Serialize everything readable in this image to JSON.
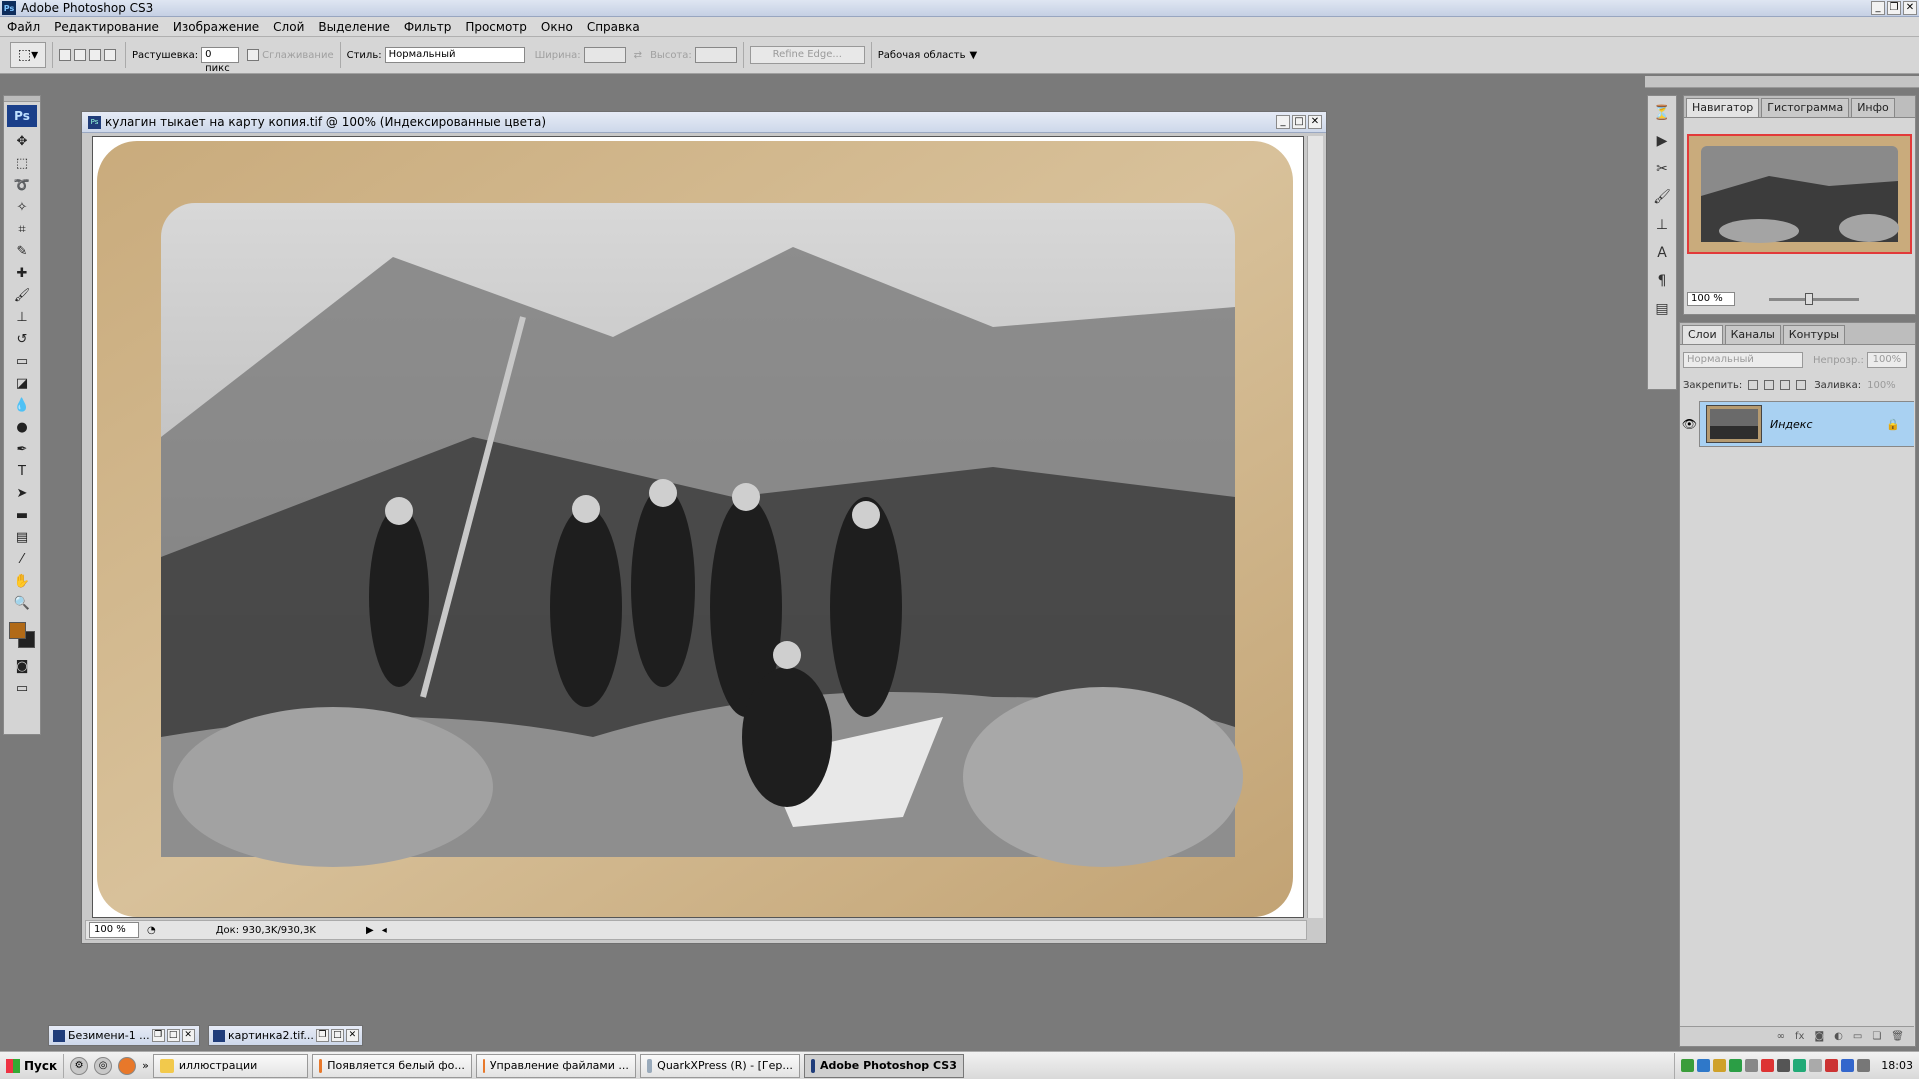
{
  "app": {
    "title": "Adobe Photoshop CS3",
    "icon": "ps-app-icon"
  },
  "menu": [
    "Файл",
    "Редактирование",
    "Изображение",
    "Слой",
    "Выделение",
    "Фильтр",
    "Просмотр",
    "Окно",
    "Справка"
  ],
  "options": {
    "feather_label": "Растушевка:",
    "feather_value": "0 пикс",
    "antialias_label": "Сглаживание",
    "style_label": "Стиль:",
    "style_value": "Нормальный",
    "width_label": "Ширина:",
    "height_label": "Высота:",
    "refine_edge": "Refine Edge...",
    "workspace": "Рабочая область"
  },
  "document": {
    "title": "кулагин тыкает на карту копия.tif @ 100% (Индексированные цвета)",
    "zoom": "100 %",
    "doc_info": "Док: 930,3K/930,3K"
  },
  "navigator": {
    "tabs": [
      "Навигатор",
      "Гистограмма",
      "Инфо"
    ],
    "zoom": "100 %"
  },
  "layers": {
    "tabs": [
      "Слои",
      "Каналы",
      "Контуры"
    ],
    "blend_mode": "Нормальный",
    "opacity_label": "Непрозр.:",
    "opacity_value": "100%",
    "lock_label": "Закрепить:",
    "fill_label": "Заливка:",
    "fill_value": "100%",
    "layer_name": "Индекс"
  },
  "minimized": [
    {
      "label": "Безимени-1 ..."
    },
    {
      "label": "картинка2.tif..."
    }
  ],
  "taskbar": {
    "start": "Пуск",
    "tasks": [
      "иллюстрации",
      "Появляется белый фо...",
      "Управление файлами ...",
      "QuarkXPress (R) - [Гер...",
      "Adobe Photoshop CS3"
    ],
    "clock": "18:03"
  },
  "colors": {
    "foreground": "#b16a17",
    "background": "#222222",
    "selected_layer": "#a9d1f2"
  }
}
